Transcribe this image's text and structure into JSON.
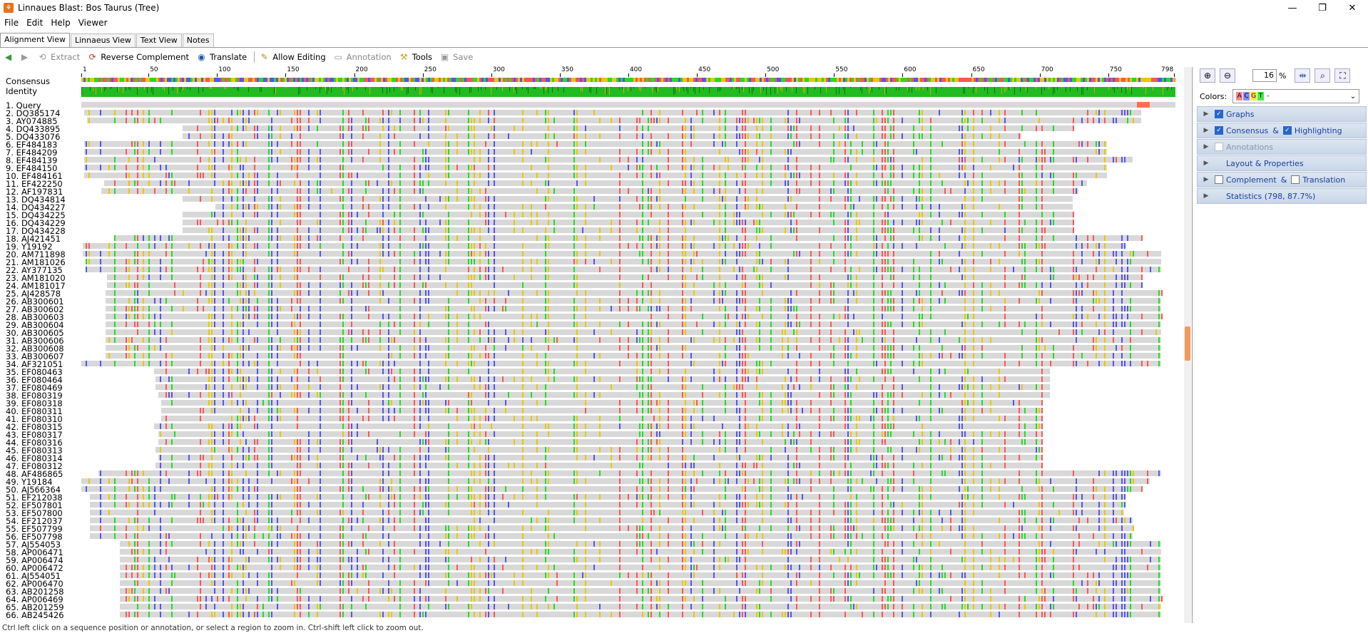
{
  "window": {
    "title": "Linnaues Blast: Bos Taurus (Tree)",
    "minimize": "—",
    "maximize": "❐",
    "close": "✕"
  },
  "menu": [
    "File",
    "Edit",
    "Help",
    "Viewer"
  ],
  "tabs": [
    "Alignment View",
    "Linnaeus View",
    "Text View",
    "Notes"
  ],
  "toolbar": {
    "extract": "Extract",
    "reverse_complement": "Reverse Complement",
    "translate": "Translate",
    "allow_editing": "Allow Editing",
    "annotation": "Annotation",
    "tools": "Tools",
    "save": "Save"
  },
  "alignment": {
    "consensus_label": "Consensus",
    "identity_label": "Identity",
    "ruler_ticks": [
      "1",
      "50",
      "100",
      "150",
      "200",
      "250",
      "300",
      "350",
      "400",
      "450",
      "500",
      "550",
      "600",
      "650",
      "700",
      "750",
      "798"
    ],
    "sequences": [
      "1. Query",
      "2. DQ385174",
      "3. AY074885",
      "4. DQ433895",
      "5. DQ433076",
      "6. EF484183",
      "7. EF484209",
      "8. EF484139",
      "9. EF484150",
      "10. EF484161",
      "11. EF422250",
      "12. AF197831",
      "13. DQ434814",
      "14. DQ434227",
      "15. DQ434225",
      "16. DQ434229",
      "17. DQ434228",
      "18. AJ421451",
      "19. Y19192",
      "20. AM711898",
      "21. AM181026",
      "22. AY377135",
      "23. AM181020",
      "24. AM181017",
      "25. AJ428578",
      "26. AB300601",
      "27. AB300602",
      "28. AB300603",
      "29. AB300604",
      "30. AB300605",
      "31. AB300606",
      "32. AB300608",
      "33. AB300607",
      "34. AF321051",
      "35. EF080463",
      "36. EF080464",
      "37. EF080469",
      "38. EF080319",
      "39. EF080318",
      "40. EF080311",
      "41. EF080310",
      "42. EF080315",
      "43. EF080317",
      "44. EF080316",
      "45. EF080313",
      "46. EF080314",
      "47. EF080312",
      "48. AF486865",
      "49. Y19184",
      "50. AJ566364",
      "51. EF212038",
      "52. EF507801",
      "53. EF507800",
      "54. EF212037",
      "55. EF507799",
      "56. EF507798",
      "57. AJ554053",
      "58. AP006471",
      "59. AP006474",
      "60. AP006472",
      "61. AJ554051",
      "62. AP006470",
      "63. AB201258",
      "64. AP006469",
      "65. AB201259",
      "66. AB245426"
    ]
  },
  "side": {
    "zoom_value": "16",
    "zoom_unit": "%",
    "colors_label": "Colors:",
    "color_letters": [
      "A",
      "C",
      "G",
      "T",
      "-"
    ],
    "sections": {
      "graphs": "Graphs",
      "consensus": "Consensus",
      "amp": "&",
      "highlighting": "Highlighting",
      "annotations": "Annotations",
      "layout": "Layout & Properties",
      "complement": "Complement",
      "amp2": "&",
      "translation": "Translation",
      "statistics": "Statistics (798, 87.7%)"
    }
  },
  "status": "Ctrl left click on a sequence position or annotation, or select a region to zoom in. Ctrl-shift left click to zoom out.",
  "colors": {
    "A": "#ff5555",
    "C": "#5555ee",
    "G": "#e8c800",
    "T": "#22dd22",
    "gap": "#d8d8d8"
  }
}
